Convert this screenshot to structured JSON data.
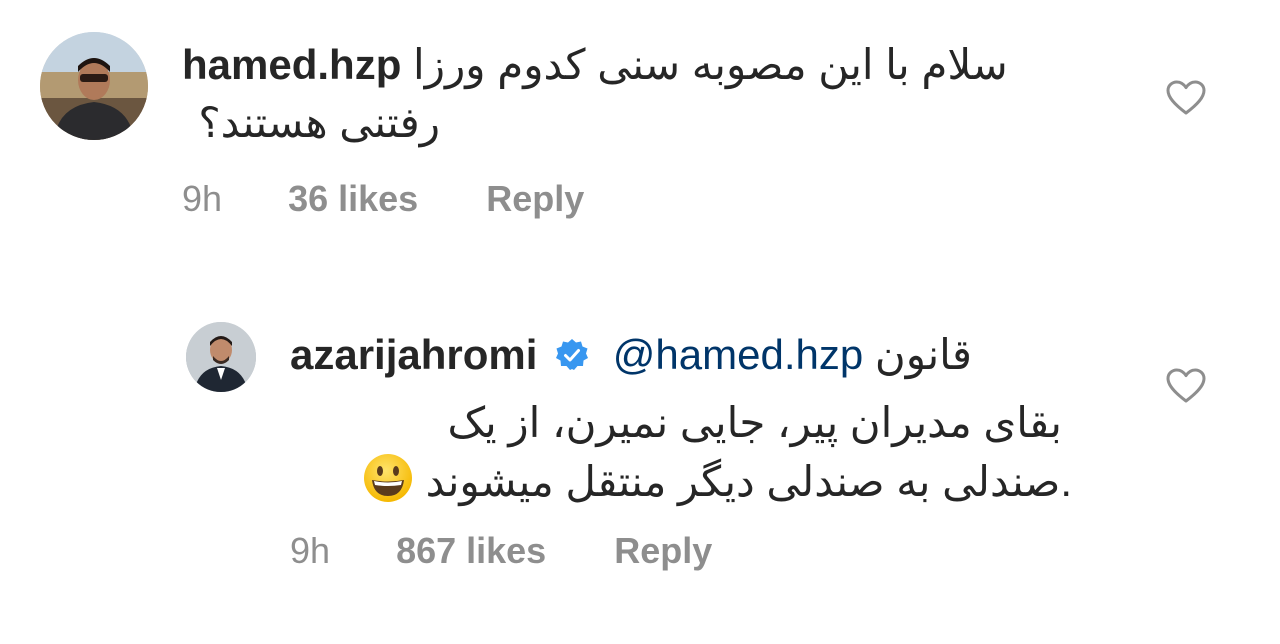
{
  "comments": [
    {
      "username": "hamed.hzp",
      "text_line1": "سلام با این مصوبه سنی کدوم ورزا",
      "text_line2": "رفتنی هستند؟",
      "time": "9h",
      "likes": "36 likes",
      "reply_label": "Reply",
      "avatar_icon": "user-avatar-photo",
      "like_icon": "heart-outline-icon"
    },
    {
      "username": "azarijahromi",
      "verified": true,
      "mention": "@hamed.hzp",
      "text_line1": "قانون",
      "text_line2": "بقای مدیران پیر، جایی نمیرن، از یک",
      "text_line3": ".صندلی به صندلی دیگر منتقل میشوند",
      "emoji": "grinning-face-emoji",
      "time": "9h",
      "likes": "867 likes",
      "reply_label": "Reply",
      "avatar_icon": "user-avatar-photo",
      "like_icon": "heart-outline-icon"
    }
  ],
  "colors": {
    "text": "#262626",
    "meta": "#8e8e8e",
    "mention": "#003569",
    "verified": "#3897f0"
  }
}
